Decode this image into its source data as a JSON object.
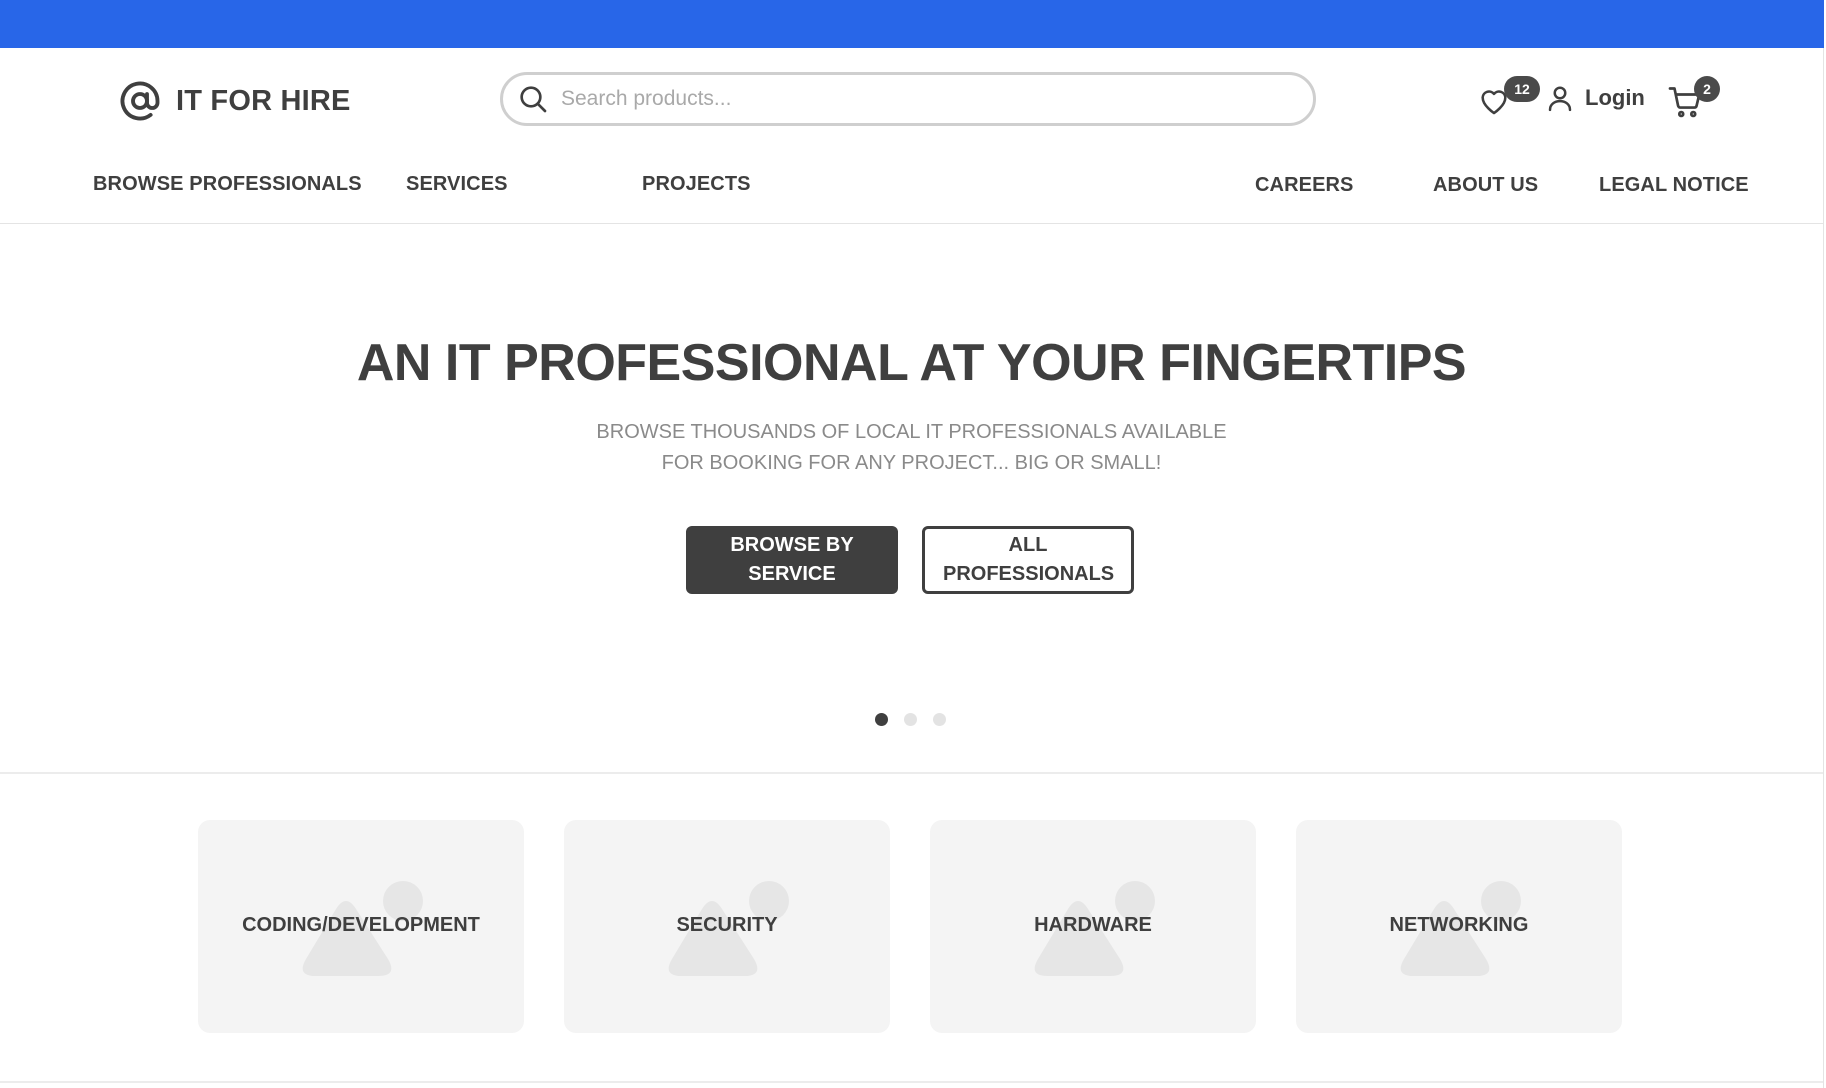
{
  "brand": {
    "name": "IT FOR HIRE",
    "accent_color": "#2866e8"
  },
  "search": {
    "placeholder": "Search products..."
  },
  "header": {
    "wishlist_count": "12",
    "login_label": "Login",
    "cart_count": "2"
  },
  "nav": {
    "left": [
      "BROWSE PROFESSIONALS",
      "SERVICES",
      "PROJECTS"
    ],
    "right": [
      "CAREERS",
      "ABOUT US",
      "LEGAL NOTICE"
    ]
  },
  "hero": {
    "title": "AN IT PROFESSIONAL AT YOUR FINGERTIPS",
    "subtitle_line1": "BROWSE THOUSANDS OF LOCAL IT PROFESSIONALS AVAILABLE",
    "subtitle_line2": "FOR BOOKING FOR ANY PROJECT... BIG OR SMALL!",
    "primary_button": "BROWSE BY SERVICE",
    "secondary_button": "ALL PROFESSIONALS",
    "slides": 3,
    "active_slide": 1
  },
  "categories": [
    "CODING/DEVELOPMENT",
    "SECURITY",
    "HARDWARE",
    "NETWORKING"
  ],
  "icons": [
    "at-sign-logo-icon",
    "search-icon",
    "heart-icon",
    "user-icon",
    "cart-icon",
    "image-placeholder-icon"
  ]
}
